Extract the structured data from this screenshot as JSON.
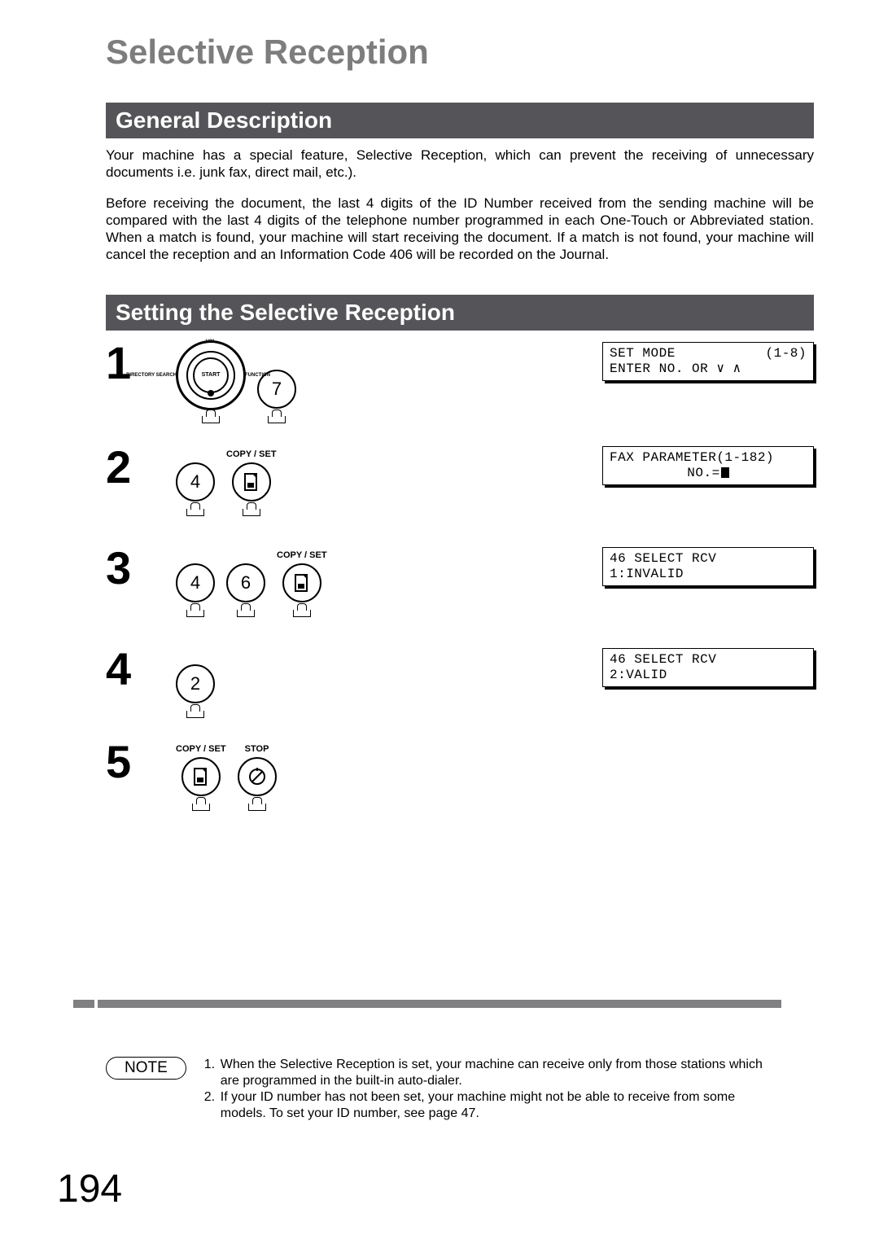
{
  "page_title": "Selective Reception",
  "page_number": "194",
  "sections": {
    "general": {
      "heading": "General Description",
      "p1": "Your machine has a special feature, Selective Reception, which can prevent the receiving of unnecessary documents i.e. junk fax, direct mail, etc.).",
      "p2": "Before receiving the document, the last 4 digits of the ID Number received from the sending machine will be compared with the last 4 digits of the telephone number programmed in each One-Touch or Abbreviated station. When a match is found, your machine will start receiving the document. If a match is not found, your machine will cancel the reception and an Information Code 406 will be recorded on the Journal."
    },
    "setting": {
      "heading": "Setting the Selective Reception"
    }
  },
  "jog": {
    "center": "START",
    "top": "VOL",
    "left": "DIRECTORY\nSEARCH",
    "right": "FUNCTION"
  },
  "key_labels": {
    "copy_set": "COPY / SET",
    "stop": "STOP"
  },
  "steps": [
    {
      "num": "1",
      "keys": [
        "7"
      ],
      "jog": true,
      "lcd": {
        "l1a": "SET MODE",
        "l1b": "(1-8)",
        "l2": "ENTER NO. OR ∨ ∧"
      }
    },
    {
      "num": "2",
      "keys": [
        "4"
      ],
      "copyset": true,
      "lcd": {
        "l1a": "FAX PARAMETER(1-182)",
        "l1b": "",
        "l2center": "NO.=",
        "cursor": true
      }
    },
    {
      "num": "3",
      "keys": [
        "4",
        "6"
      ],
      "copyset": true,
      "lcd": {
        "l1a": "46 SELECT RCV",
        "l1b": "",
        "l2": " 1:INVALID"
      }
    },
    {
      "num": "4",
      "keys": [
        "2"
      ],
      "lcd": {
        "l1a": "46 SELECT RCV",
        "l1b": "",
        "l2": " 2:VALID"
      }
    },
    {
      "num": "5",
      "copyset_stop": true
    }
  ],
  "note": {
    "label": "NOTE",
    "items": [
      {
        "n": "1.",
        "t": "When the Selective Reception is set, your machine can receive only from those stations which are programmed in the built-in auto-dialer."
      },
      {
        "n": "2.",
        "t": "If your ID number has not been set, your machine might not be able to receive from some models.  To set your ID number, see page 47."
      }
    ]
  }
}
